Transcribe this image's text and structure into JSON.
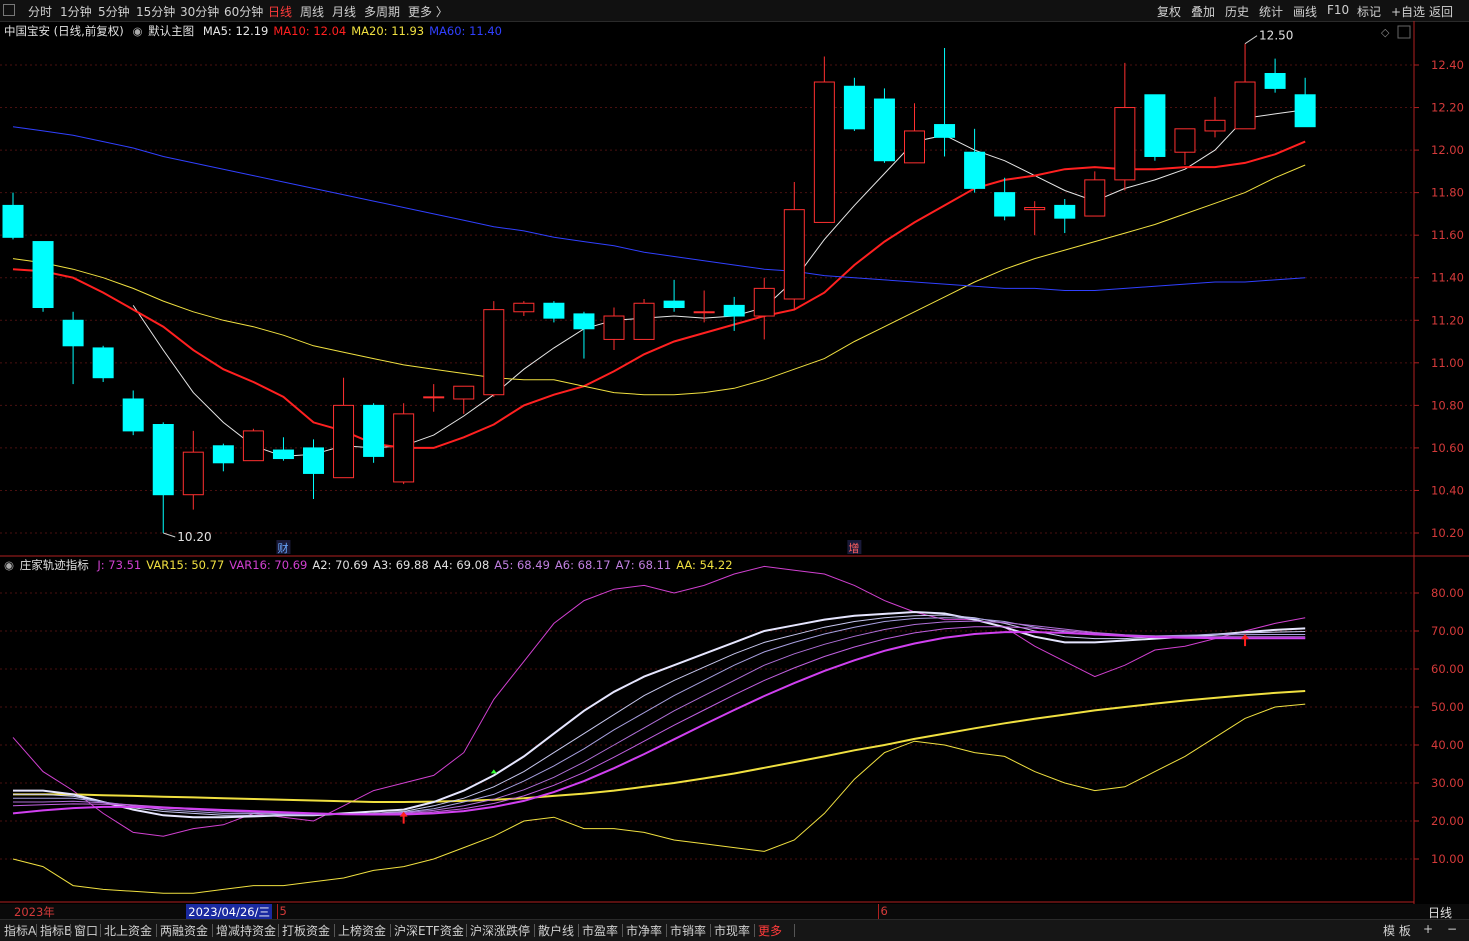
{
  "topbar": {
    "periods": [
      "分时",
      "1分钟",
      "5分钟",
      "15分钟",
      "30分钟",
      "60分钟",
      "日线",
      "周线",
      "月线",
      "多周期",
      "更多 〉"
    ],
    "active_period": "日线",
    "tools": [
      "复权",
      "叠加",
      "历史",
      "统计",
      "画线",
      "F10",
      "标记",
      "+自选",
      "返回"
    ]
  },
  "main_legend": {
    "stock": "中国宝安 (日线,前复权)",
    "template": "默认主图",
    "items": [
      {
        "text": "MA5: 12.19",
        "color": "#e6e6e6"
      },
      {
        "text": "MA10: 12.04",
        "color": "#ff2020"
      },
      {
        "text": "MA20: 11.93",
        "color": "#f0e040"
      },
      {
        "text": "MA60: 11.40",
        "color": "#3040ff"
      }
    ]
  },
  "sub_legend": {
    "name": "庄家轨迹指标",
    "items": [
      {
        "text": "J: 73.51",
        "color": "#d040d0"
      },
      {
        "text": "VAR15: 50.77",
        "color": "#f0e040"
      },
      {
        "text": "VAR16: 70.69",
        "color": "#d040d0"
      },
      {
        "text": "A2: 70.69",
        "color": "#e0e0e0"
      },
      {
        "text": "A3: 69.88",
        "color": "#e0e0e0"
      },
      {
        "text": "A4: 69.08",
        "color": "#e0e0e0"
      },
      {
        "text": "A5: 68.49",
        "color": "#c080e0"
      },
      {
        "text": "A6: 68.17",
        "color": "#c080e0"
      },
      {
        "text": "A7: 68.11",
        "color": "#c080e0"
      },
      {
        "text": "AA: 54.22",
        "color": "#f0e040"
      }
    ]
  },
  "chart_data": [
    {
      "type": "candlestick",
      "title": "中国宝安 (日线,前复权)",
      "ylim": [
        10.15,
        12.55
      ],
      "yticks": [
        "12.40",
        "12.20",
        "12.00",
        "11.80",
        "11.60",
        "11.40",
        "11.20",
        "11.00",
        "10.80",
        "10.60",
        "10.40",
        "10.20"
      ],
      "up_color": "#ff3030",
      "down_color": "#00ffff",
      "candles": [
        {
          "o": 11.74,
          "h": 11.8,
          "l": 11.58,
          "c": 11.59
        },
        {
          "o": 11.57,
          "h": 11.57,
          "l": 11.24,
          "c": 11.26
        },
        {
          "o": 11.2,
          "h": 11.24,
          "l": 10.9,
          "c": 11.08
        },
        {
          "o": 11.07,
          "h": 11.08,
          "l": 10.91,
          "c": 10.93
        },
        {
          "o": 10.83,
          "h": 10.87,
          "l": 10.66,
          "c": 10.68
        },
        {
          "o": 10.71,
          "h": 10.72,
          "l": 10.2,
          "c": 10.38
        },
        {
          "o": 10.38,
          "h": 10.68,
          "l": 10.31,
          "c": 10.58
        },
        {
          "o": 10.61,
          "h": 10.62,
          "l": 10.49,
          "c": 10.53
        },
        {
          "o": 10.54,
          "h": 10.69,
          "l": 10.54,
          "c": 10.68
        },
        {
          "o": 10.59,
          "h": 10.65,
          "l": 10.54,
          "c": 10.55
        },
        {
          "o": 10.6,
          "h": 10.64,
          "l": 10.36,
          "c": 10.48
        },
        {
          "o": 10.46,
          "h": 10.93,
          "l": 10.46,
          "c": 10.8
        },
        {
          "o": 10.8,
          "h": 10.81,
          "l": 10.53,
          "c": 10.56
        },
        {
          "o": 10.44,
          "h": 10.81,
          "l": 10.43,
          "c": 10.76
        },
        {
          "o": 10.84,
          "h": 10.9,
          "l": 10.77,
          "c": 10.84
        },
        {
          "o": 10.83,
          "h": 10.89,
          "l": 10.76,
          "c": 10.89
        },
        {
          "o": 10.85,
          "h": 11.29,
          "l": 10.84,
          "c": 11.25
        },
        {
          "o": 11.24,
          "h": 11.29,
          "l": 11.22,
          "c": 11.28
        },
        {
          "o": 11.28,
          "h": 11.29,
          "l": 11.19,
          "c": 11.21
        },
        {
          "o": 11.23,
          "h": 11.24,
          "l": 11.02,
          "c": 11.16
        },
        {
          "o": 11.11,
          "h": 11.26,
          "l": 11.06,
          "c": 11.22
        },
        {
          "o": 11.11,
          "h": 11.3,
          "l": 11.11,
          "c": 11.28
        },
        {
          "o": 11.29,
          "h": 11.39,
          "l": 11.24,
          "c": 11.26
        },
        {
          "o": 11.24,
          "h": 11.34,
          "l": 11.19,
          "c": 11.24
        },
        {
          "o": 11.27,
          "h": 11.31,
          "l": 11.15,
          "c": 11.22
        },
        {
          "o": 11.22,
          "h": 11.4,
          "l": 11.11,
          "c": 11.35
        },
        {
          "o": 11.3,
          "h": 11.85,
          "l": 11.25,
          "c": 11.72
        },
        {
          "o": 11.66,
          "h": 12.44,
          "l": 11.66,
          "c": 12.32
        },
        {
          "o": 12.3,
          "h": 12.34,
          "l": 12.09,
          "c": 12.1
        },
        {
          "o": 12.24,
          "h": 12.29,
          "l": 11.94,
          "c": 11.95
        },
        {
          "o": 11.94,
          "h": 12.22,
          "l": 11.94,
          "c": 12.09
        },
        {
          "o": 12.12,
          "h": 12.48,
          "l": 11.97,
          "c": 12.06
        },
        {
          "o": 11.99,
          "h": 12.1,
          "l": 11.8,
          "c": 11.82
        },
        {
          "o": 11.8,
          "h": 11.87,
          "l": 11.67,
          "c": 11.69
        },
        {
          "o": 11.72,
          "h": 11.76,
          "l": 11.6,
          "c": 11.73
        },
        {
          "o": 11.74,
          "h": 11.77,
          "l": 11.61,
          "c": 11.68
        },
        {
          "o": 11.69,
          "h": 11.9,
          "l": 11.69,
          "c": 11.86
        },
        {
          "o": 11.86,
          "h": 12.41,
          "l": 11.81,
          "c": 12.2
        },
        {
          "o": 12.26,
          "h": 12.26,
          "l": 11.95,
          "c": 11.97
        },
        {
          "o": 11.99,
          "h": 12.1,
          "l": 11.93,
          "c": 12.1
        },
        {
          "o": 12.09,
          "h": 12.25,
          "l": 12.06,
          "c": 12.14
        },
        {
          "o": 12.1,
          "h": 12.5,
          "l": 12.1,
          "c": 12.32
        },
        {
          "o": 12.36,
          "h": 12.43,
          "l": 12.27,
          "c": 12.29
        },
        {
          "o": 12.26,
          "h": 12.34,
          "l": 12.11,
          "c": 12.11
        }
      ],
      "series": [
        {
          "name": "MA5",
          "color": "#e6e6e6",
          "values": [
            null,
            null,
            null,
            null,
            11.27,
            11.06,
            10.86,
            10.72,
            10.61,
            10.56,
            10.57,
            10.61,
            10.6,
            10.61,
            10.66,
            10.75,
            10.85,
            10.97,
            11.07,
            11.16,
            11.2,
            11.21,
            11.22,
            11.21,
            11.22,
            11.26,
            11.39,
            11.58,
            11.74,
            11.89,
            12.04,
            12.07,
            12.0,
            11.95,
            11.88,
            11.81,
            11.76,
            11.82,
            11.86,
            11.91,
            12.0,
            12.15,
            12.17,
            12.19
          ]
        },
        {
          "name": "MA10",
          "color": "#ff2020",
          "values": [
            11.44,
            11.43,
            11.4,
            11.33,
            11.25,
            11.17,
            11.06,
            10.97,
            10.91,
            10.84,
            10.72,
            10.68,
            10.62,
            10.6,
            10.6,
            10.65,
            10.71,
            10.8,
            10.85,
            10.89,
            10.96,
            11.04,
            11.1,
            11.14,
            11.18,
            11.22,
            11.25,
            11.33,
            11.46,
            11.57,
            11.66,
            11.74,
            11.82,
            11.86,
            11.88,
            11.91,
            11.92,
            11.91,
            11.91,
            11.92,
            11.92,
            11.94,
            11.98,
            12.04
          ]
        },
        {
          "name": "MA20",
          "color": "#f0e040",
          "values": [
            11.49,
            11.47,
            11.44,
            11.4,
            11.35,
            11.29,
            11.24,
            11.2,
            11.17,
            11.13,
            11.08,
            11.05,
            11.02,
            10.99,
            10.97,
            10.95,
            10.93,
            10.92,
            10.92,
            10.89,
            10.86,
            10.85,
            10.85,
            10.86,
            10.88,
            10.92,
            10.97,
            11.02,
            11.1,
            11.17,
            11.24,
            11.31,
            11.38,
            11.44,
            11.49,
            11.53,
            11.57,
            11.61,
            11.65,
            11.7,
            11.75,
            11.8,
            11.87,
            11.93
          ]
        },
        {
          "name": "MA60",
          "color": "#3040ff",
          "values": [
            12.11,
            12.09,
            12.07,
            12.04,
            12.01,
            11.97,
            11.94,
            11.91,
            11.88,
            11.85,
            11.82,
            11.79,
            11.76,
            11.73,
            11.7,
            11.67,
            11.64,
            11.62,
            11.59,
            11.57,
            11.55,
            11.52,
            11.5,
            11.48,
            11.46,
            11.44,
            11.43,
            11.41,
            11.4,
            11.39,
            11.38,
            11.37,
            11.36,
            11.35,
            11.35,
            11.34,
            11.34,
            11.35,
            11.36,
            11.37,
            11.38,
            11.38,
            11.39,
            11.4
          ]
        }
      ],
      "annotations": [
        {
          "text": "10.20",
          "at_index": 5,
          "price": 10.2
        },
        {
          "text": "12.50",
          "at_index": 41,
          "price": 12.5
        }
      ],
      "event_markers": [
        {
          "text": "财",
          "at_index": 9
        },
        {
          "text": "增",
          "at_index": 28
        }
      ]
    },
    {
      "type": "line",
      "title": "庄家轨迹指标",
      "ylim": [
        0,
        90
      ],
      "yticks": [
        "80.00",
        "70.00",
        "60.00",
        "50.00",
        "40.00",
        "30.00",
        "20.00",
        "10.00"
      ],
      "series": [
        {
          "name": "J",
          "color": "#d040d0",
          "values": [
            42,
            33,
            28,
            22,
            17,
            16,
            18,
            19,
            22,
            21,
            20,
            24,
            28,
            30,
            32,
            38,
            52,
            62,
            72,
            78,
            81,
            82,
            80,
            82,
            85,
            87,
            86,
            85,
            82,
            78,
            75,
            73,
            73,
            71,
            66,
            62,
            58,
            61,
            65,
            66,
            68,
            70,
            72,
            73.5
          ]
        },
        {
          "name": "VAR15",
          "color": "#f0e040",
          "values": [
            10,
            8,
            3,
            2,
            1.5,
            1,
            1,
            2,
            3,
            3,
            4,
            5,
            7,
            8,
            10,
            13,
            16,
            20,
            21,
            18,
            18,
            17,
            15,
            14,
            13,
            12,
            15,
            22,
            31,
            38,
            41,
            40,
            38,
            37,
            33,
            30,
            28,
            29,
            33,
            37,
            42,
            47,
            50,
            50.77
          ]
        },
        {
          "name": "AA",
          "color": "#f0e040",
          "values": [
            27,
            27,
            27,
            26.8,
            26.6,
            26.4,
            26.2,
            26,
            25.8,
            25.6,
            25.4,
            25.2,
            25,
            25,
            25.1,
            25.3,
            25.6,
            26,
            26.6,
            27.2,
            28,
            29,
            30,
            31.2,
            32.5,
            34,
            35.5,
            37,
            38.6,
            40,
            41.6,
            43,
            44.4,
            45.7,
            46.9,
            48,
            49.1,
            50,
            50.9,
            51.7,
            52.4,
            53.1,
            53.7,
            54.22
          ]
        },
        {
          "name": "A2",
          "color": "#e6e6ff",
          "values": [
            28,
            28,
            27,
            25,
            23,
            21.5,
            21,
            21,
            21.2,
            21.5,
            21.5,
            22,
            22.5,
            23,
            25,
            28,
            32,
            37,
            43,
            49,
            54,
            58,
            61,
            64,
            67,
            70,
            71.5,
            73,
            74,
            74.5,
            75,
            74.6,
            73,
            71,
            68.5,
            67,
            67,
            67.5,
            68,
            68.5,
            69,
            69.7,
            70.3,
            70.69
          ]
        },
        {
          "name": "A3",
          "color": "#c8c8ef",
          "values": [
            27,
            27,
            26.5,
            25,
            23.5,
            22.5,
            22,
            21.5,
            21.5,
            21.5,
            21.5,
            21.8,
            22,
            22.5,
            24,
            26,
            29,
            33,
            38,
            43,
            48,
            53,
            57,
            60.5,
            64,
            67,
            69,
            71,
            72.5,
            73.5,
            74,
            74.2,
            73.5,
            72,
            70,
            68.5,
            68,
            68,
            68.5,
            68.8,
            69.2,
            69.5,
            69.7,
            69.88
          ]
        },
        {
          "name": "A4",
          "color": "#a8a0e0",
          "values": [
            26,
            26,
            26,
            25,
            24,
            23,
            22.5,
            22,
            22,
            21.8,
            21.7,
            21.8,
            22,
            22.3,
            23.2,
            25,
            27,
            30.5,
            34.5,
            39,
            44,
            48.5,
            53,
            57,
            61,
            64.5,
            67,
            69.2,
            71,
            72.5,
            73.3,
            73.5,
            73.3,
            72.5,
            71,
            69.8,
            69,
            68.7,
            68.7,
            68.9,
            69,
            69.05,
            69.07,
            69.08
          ]
        },
        {
          "name": "A5",
          "color": "#b070d8",
          "values": [
            25,
            25,
            25.2,
            24.8,
            24.2,
            23.5,
            23,
            22.5,
            22.3,
            22,
            21.8,
            21.8,
            22,
            22.2,
            22.8,
            24,
            25.7,
            28.2,
            31.5,
            35.5,
            40,
            44.5,
            49,
            53,
            57,
            61,
            64,
            66.5,
            68.6,
            70.4,
            71.7,
            72.4,
            72.6,
            72.2,
            71.4,
            70.5,
            69.6,
            69,
            68.7,
            68.6,
            68.5,
            68.5,
            68.5,
            68.49
          ]
        },
        {
          "name": "A6",
          "color": "#c060e0",
          "values": [
            24,
            24.3,
            24.5,
            24.4,
            24.2,
            23.7,
            23.3,
            22.8,
            22.6,
            22.3,
            22,
            21.8,
            21.8,
            22,
            22.4,
            23.2,
            24.6,
            26.6,
            29.4,
            32.8,
            36.8,
            41,
            45.2,
            49.2,
            53.2,
            57,
            60.3,
            63.3,
            65.8,
            67.9,
            69.5,
            70.6,
            71.1,
            71.1,
            70.7,
            70.1,
            69.4,
            68.9,
            68.5,
            68.3,
            68.2,
            68.17,
            68.17,
            68.17
          ]
        },
        {
          "name": "A7",
          "color": "#d040f0",
          "values": [
            22,
            22.8,
            23.4,
            23.7,
            23.7,
            23.5,
            23.2,
            22.9,
            22.6,
            22.3,
            22,
            21.8,
            21.7,
            21.7,
            22,
            22.6,
            23.7,
            25.3,
            27.6,
            30.5,
            33.9,
            37.6,
            41.5,
            45.4,
            49.2,
            52.9,
            56.3,
            59.5,
            62.3,
            64.8,
            66.7,
            68.2,
            69.2,
            69.7,
            69.7,
            69.5,
            69.1,
            68.7,
            68.4,
            68.2,
            68.12,
            68.11,
            68.11,
            68.11
          ]
        }
      ],
      "signals": [
        {
          "type": "up-arrow",
          "color": "#ff2020",
          "at_index": 13
        },
        {
          "type": "marker",
          "color": "#30ff30",
          "at_index": 16
        },
        {
          "type": "up-arrow",
          "color": "#ff2020",
          "at_index": 41
        }
      ]
    }
  ],
  "date_axis": {
    "labels": [
      {
        "text": "2023年",
        "at_index": 0
      },
      {
        "text": "2023/04/26/三",
        "at_index": 6,
        "highlight": true
      },
      {
        "text": "5",
        "at_index": 9
      },
      {
        "text": "6",
        "at_index": 29
      }
    ],
    "right_label": "日线"
  },
  "bottom_tabs": [
    "指标A",
    "指标B",
    "窗口",
    "北上资金",
    "两融资金",
    "增减持资金",
    "打板资金",
    "上榜资金",
    "沪深ETF资金",
    "沪深涨跌停",
    "散户线",
    "市盈率",
    "市净率",
    "市销率",
    "市现率",
    "更多"
  ],
  "bottom_right": [
    "模 板",
    "+",
    "−"
  ]
}
